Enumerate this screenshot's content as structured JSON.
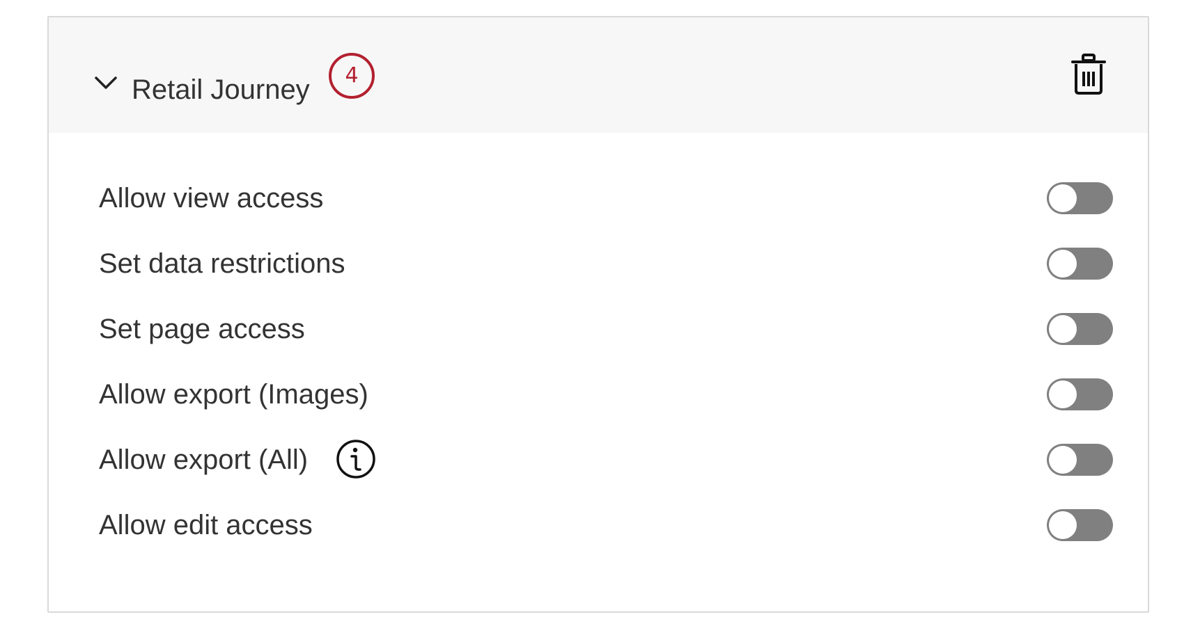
{
  "header": {
    "title": "Retail Journey",
    "step_badge": "4",
    "collapse_icon": "chevron-down-icon",
    "delete_icon": "trash-icon"
  },
  "permissions": [
    {
      "label": "Allow view access",
      "enabled": false
    },
    {
      "label": "Set data restrictions",
      "enabled": false
    },
    {
      "label": "Set page access",
      "enabled": false
    },
    {
      "label": "Allow export (Images)",
      "enabled": false
    },
    {
      "label": "Allow export (All)",
      "enabled": false,
      "info_icon": "info-icon"
    },
    {
      "label": "Allow edit access",
      "enabled": false
    }
  ],
  "colors": {
    "badge": "#b3202f",
    "toggle_off": "#808080",
    "header_bg": "#f7f7f7",
    "text": "#333333"
  }
}
